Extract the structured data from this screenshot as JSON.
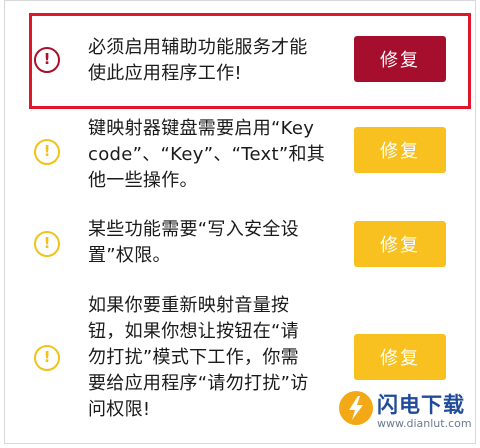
{
  "colors": {
    "highlight_border": "#e0162b",
    "primary_button": "#a50f2d",
    "warning_button": "#f8c11f",
    "error_icon": "#a8102c",
    "warning_icon": "#f0c21a",
    "watermark_text": "#1f4b99",
    "watermark_logo": "#f2a915"
  },
  "items": [
    {
      "icon": "error-exclamation-icon",
      "lines": [
        "必须启用辅助功能服务才能",
        "使此应用程序工作!"
      ],
      "button_label": "修复"
    },
    {
      "icon": "warning-exclamation-icon",
      "lines": [
        "键映射器键盘需要启用“Key",
        "code”、“Key”、“Text”和其",
        "他一些操作。"
      ],
      "button_label": "修复"
    },
    {
      "icon": "warning-exclamation-icon",
      "lines": [
        "某些功能需要“写入安全设",
        "置”权限。"
      ],
      "button_label": "修复"
    },
    {
      "icon": "warning-exclamation-icon",
      "lines": [
        "如果你要重新映射音量按",
        "钮，如果你想让按钮在“请",
        "勿打扰”模式下工作，你需",
        "要给应用程序“请勿打扰”访",
        "问权限!"
      ],
      "button_label": "修复"
    }
  ],
  "icon_glyph": "!",
  "watermark": {
    "title": "闪电下载",
    "url": "www.dianlut.com"
  }
}
